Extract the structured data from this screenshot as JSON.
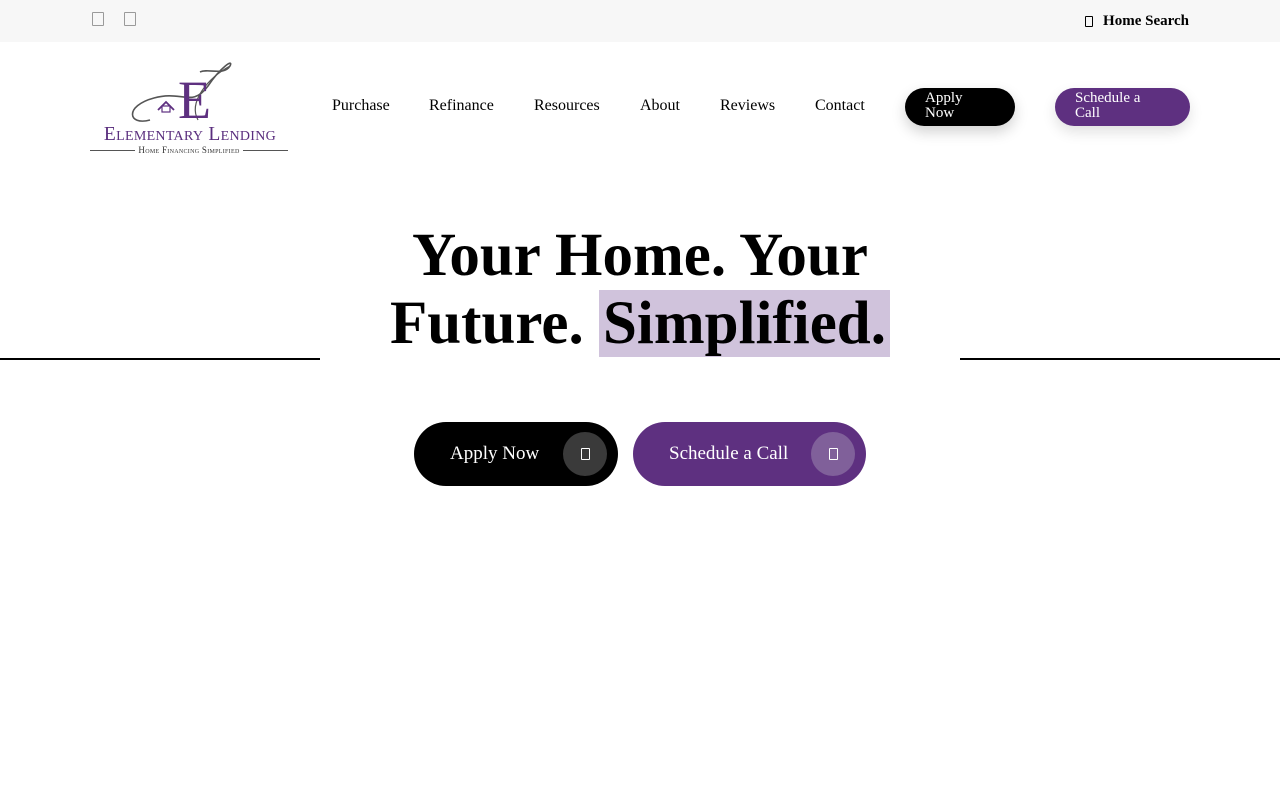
{
  "topbar": {
    "social_icons": [
      "facebook-icon",
      "instagram-icon"
    ],
    "home_search_icon": "house-icon",
    "home_search_label": "Home Search"
  },
  "logo": {
    "monogram": "E",
    "brand": "Elementary Lending",
    "tagline": "Home Financing Simplified"
  },
  "nav": {
    "items": [
      "Purchase",
      "Refinance",
      "Resources",
      "About",
      "Reviews",
      "Contact"
    ],
    "apply_label": "Apply Now",
    "schedule_label": "Schedule a Call"
  },
  "hero": {
    "title_part1": "Your Home. Your Future.",
    "title_highlight": "Simplified.",
    "apply_label": "Apply Now",
    "schedule_label": "Schedule a Call",
    "apply_icon": "arrow-icon",
    "schedule_icon": "calendar-icon"
  },
  "colors": {
    "brand_purple": "#5e3080",
    "highlight": "#d0c3dc",
    "topbar_bg": "#f7f7f7",
    "black": "#000000"
  }
}
